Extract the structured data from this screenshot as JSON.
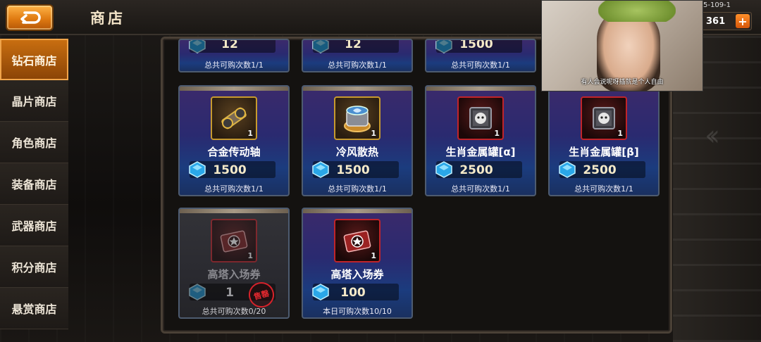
{
  "header": {
    "title": "商店",
    "level_text": "5-109-1",
    "currency_value": "361",
    "back_icon": "back-arrow-icon"
  },
  "sidebar": {
    "items": [
      {
        "label": "钻石商店",
        "active": true
      },
      {
        "label": "晶片商店",
        "active": false
      },
      {
        "label": "角色商店",
        "active": false
      },
      {
        "label": "装备商店",
        "active": false
      },
      {
        "label": "武器商店",
        "active": false
      },
      {
        "label": "积分商店",
        "active": false
      },
      {
        "label": "悬赏商店",
        "active": false
      }
    ]
  },
  "shop": {
    "top_row": [
      {
        "price": "12",
        "limit": "总共可购次数1/1"
      },
      {
        "price": "12",
        "limit": "总共可购次数1/1"
      },
      {
        "price": "1500",
        "limit": "总共可购次数1/1"
      }
    ],
    "items": [
      {
        "name": "合金传动轴",
        "count": "1",
        "price": "1500",
        "limit": "总共可购次数1/1",
        "icon": "alloy-shaft-icon",
        "frame": "gold",
        "sold_out": false
      },
      {
        "name": "冷风散热",
        "count": "1",
        "price": "1500",
        "limit": "总共可购次数1/1",
        "icon": "cooling-fan-icon",
        "frame": "gold",
        "sold_out": false
      },
      {
        "name": "生肖金属罐[α]",
        "count": "1",
        "price": "2500",
        "limit": "总共可购次数1/1",
        "icon": "zodiac-canister-icon",
        "frame": "red",
        "sold_out": false
      },
      {
        "name": "生肖金属罐[β]",
        "count": "1",
        "price": "2500",
        "limit": "总共可购次数1/1",
        "icon": "zodiac-canister-icon",
        "frame": "red",
        "sold_out": false
      },
      {
        "name": "高塔入场券",
        "count": "1",
        "price": "1",
        "limit": "总共可购次数0/20",
        "icon": "tower-ticket-icon",
        "frame": "red",
        "sold_out": true,
        "sold_out_label": "售罄"
      },
      {
        "name": "高塔入场券",
        "count": "1",
        "price": "100",
        "limit": "本日可购次数10/10",
        "icon": "tower-ticket-icon",
        "frame": "red",
        "sold_out": false
      }
    ]
  },
  "webcam": {
    "caption": "有人会说呢呀插就是个人自由"
  },
  "colors": {
    "accent_orange": "#e07b12",
    "card_purple": "#3b2a6b",
    "card_blue": "#1b3c7e",
    "price_text": "#f4e9c8"
  }
}
